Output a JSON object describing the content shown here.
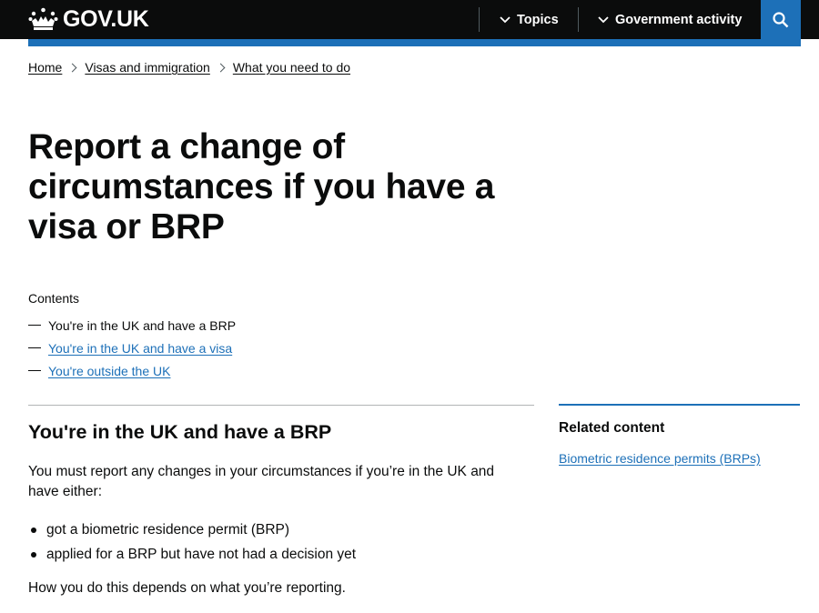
{
  "header": {
    "logo_text": "GOV.UK",
    "logo_icon": "crown-icon",
    "nav": [
      {
        "label": "Topics",
        "icon": "chevron-down-icon"
      },
      {
        "label": "Government activity",
        "icon": "chevron-down-icon"
      }
    ],
    "search_icon": "search-icon",
    "colors": {
      "header_bg": "#0b0c0c",
      "accent": "#1d70b8",
      "link": "#1d70b8"
    }
  },
  "breadcrumbs": [
    "Home",
    "Visas and immigration",
    "What you need to do"
  ],
  "page_title": "Report a change of circumstances if you have a visa or BRP",
  "contents": {
    "label": "Contents",
    "items": [
      {
        "label": "You're in the UK and have a BRP",
        "current": true
      },
      {
        "label": "You're in the UK and have a visa",
        "current": false
      },
      {
        "label": "You're outside the UK",
        "current": false
      }
    ]
  },
  "section": {
    "heading": "You're in the UK and have a BRP",
    "intro": "You must report any changes in your circumstances if you’re in the UK and have either:",
    "bullets": [
      "got a biometric residence permit (BRP)",
      "applied for a BRP but have not had a decision yet"
    ],
    "outro": "How you do this depends on what you’re reporting."
  },
  "related": {
    "heading": "Related content",
    "links": [
      "Biometric residence permits (BRPs)"
    ]
  }
}
